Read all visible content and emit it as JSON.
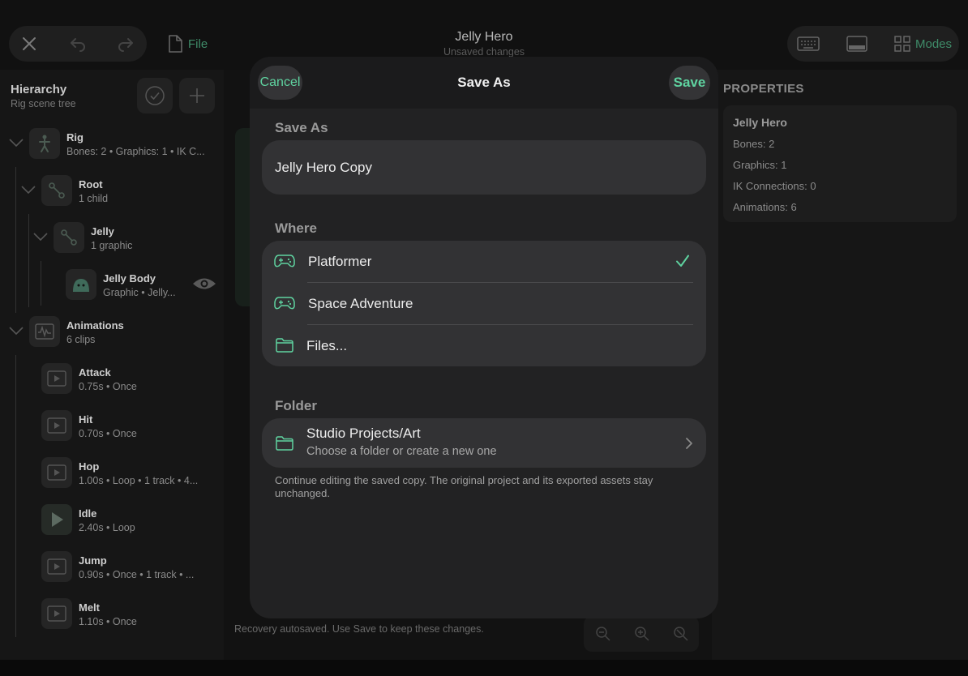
{
  "window": {
    "title": "Jelly Hero",
    "subtitle": "Unsaved changes"
  },
  "toolbar": {
    "file_label": "File",
    "modes_label": "Modes"
  },
  "colors": {
    "accent": "#5fd3a0",
    "background": "#0c0c0c",
    "panel": "#161616",
    "modal": "#222223",
    "card": "#323234"
  },
  "hierarchy": {
    "title": "Hierarchy",
    "subtitle": "Rig scene tree",
    "rig": {
      "name": "Rig",
      "sub": "Bones: 2  •  Graphics: 1  •  IK C..."
    },
    "root": {
      "name": "Root",
      "sub": "1 child"
    },
    "jelly": {
      "name": "Jelly",
      "sub": "1 graphic"
    },
    "jelly_body": {
      "name": "Jelly Body",
      "sub": "Graphic  •  Jelly..."
    },
    "animations": {
      "name": "Animations",
      "sub": "6 clips"
    },
    "clips": [
      {
        "name": "Attack",
        "sub": "0.75s  •  Once"
      },
      {
        "name": "Hit",
        "sub": "0.70s  •  Once"
      },
      {
        "name": "Hop",
        "sub": "1.00s  •  Loop  •  1 track  •  4..."
      },
      {
        "name": "Idle",
        "sub": "2.40s  •  Loop"
      },
      {
        "name": "Jump",
        "sub": "0.90s  •  Once  •  1 track  •  ..."
      },
      {
        "name": "Melt",
        "sub": "1.10s  •  Once"
      }
    ]
  },
  "status_text": "Recovery autosaved. Use Save to keep these changes.",
  "properties": {
    "header": "PROPERTIES",
    "name": "Jelly Hero",
    "lines": [
      "Bones: 2",
      "Graphics: 1",
      "IK Connections: 0",
      "Animations: 6"
    ]
  },
  "dialog": {
    "title": "Save As",
    "cancel": "Cancel",
    "save": "Save",
    "name_section": "Save As",
    "name_value": "Jelly Hero Copy",
    "where_section": "Where",
    "where_items": [
      {
        "label": "Platformer",
        "icon": "gamepad-icon",
        "selected": true
      },
      {
        "label": "Space Adventure",
        "icon": "gamepad-icon",
        "selected": false
      },
      {
        "label": "Files...",
        "icon": "folder-icon",
        "selected": false
      }
    ],
    "folder_section": "Folder",
    "folder_title": "Studio Projects/Art",
    "folder_sub": "Choose a folder or create a new one",
    "footnote": "Continue editing the saved copy. The original project and its exported assets stay unchanged."
  }
}
